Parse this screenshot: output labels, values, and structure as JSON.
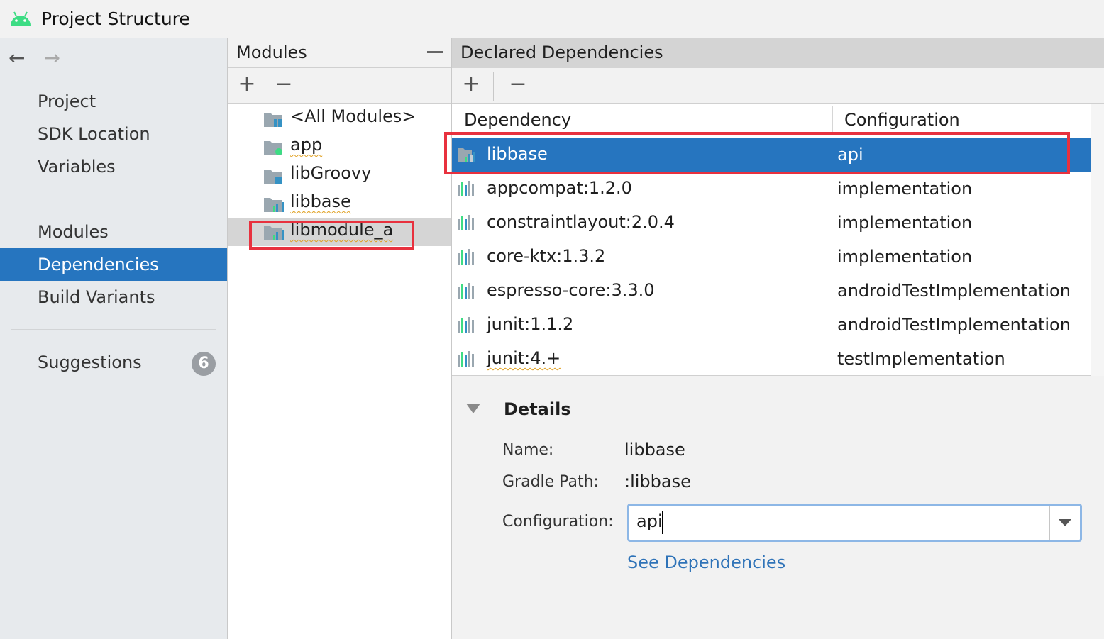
{
  "window": {
    "title": "Project Structure",
    "icon": "android-icon"
  },
  "sidebar": {
    "back_icon": "←",
    "forward_icon": "→",
    "items": [
      {
        "label": "Project"
      },
      {
        "label": "SDK Location"
      },
      {
        "label": "Variables"
      },
      {
        "label": "Modules"
      },
      {
        "label": "Dependencies",
        "selected": true
      },
      {
        "label": "Build Variants"
      },
      {
        "label": "Suggestions",
        "badge": "6"
      }
    ]
  },
  "modules": {
    "title": "Modules",
    "add": "+",
    "remove": "−",
    "items": [
      {
        "label": "<All Modules>",
        "icon": "all-modules-icon"
      },
      {
        "label": "app",
        "icon": "app-module-icon"
      },
      {
        "label": "libGroovy",
        "icon": "library-module-icon"
      },
      {
        "label": "libbase",
        "icon": "android-library-icon"
      },
      {
        "label": "libmodule_a",
        "icon": "android-library-icon",
        "selected": true
      }
    ]
  },
  "dependencies": {
    "title": "Declared Dependencies",
    "add": "+",
    "remove": "−",
    "col_dependency": "Dependency",
    "col_configuration": "Configuration",
    "rows": [
      {
        "name": "libbase",
        "configuration": "api",
        "selected": true
      },
      {
        "name": "appcompat:1.2.0",
        "configuration": "implementation"
      },
      {
        "name": "constraintlayout:2.0.4",
        "configuration": "implementation"
      },
      {
        "name": "core-ktx:1.3.2",
        "configuration": "implementation"
      },
      {
        "name": "espresso-core:3.3.0",
        "configuration": "androidTestImplementation"
      },
      {
        "name": "junit:1.1.2",
        "configuration": "androidTestImplementation"
      },
      {
        "name": "junit:4.+",
        "configuration": "testImplementation"
      }
    ]
  },
  "details": {
    "title": "Details",
    "name_label": "Name:",
    "name_value": "libbase",
    "path_label": "Gradle Path:",
    "path_value": ":libbase",
    "config_label": "Configuration:",
    "config_value": "api",
    "link": "See Dependencies"
  },
  "colors": {
    "selection": "#2675bf",
    "highlight": "#e8313e",
    "link": "#2f73b8"
  }
}
